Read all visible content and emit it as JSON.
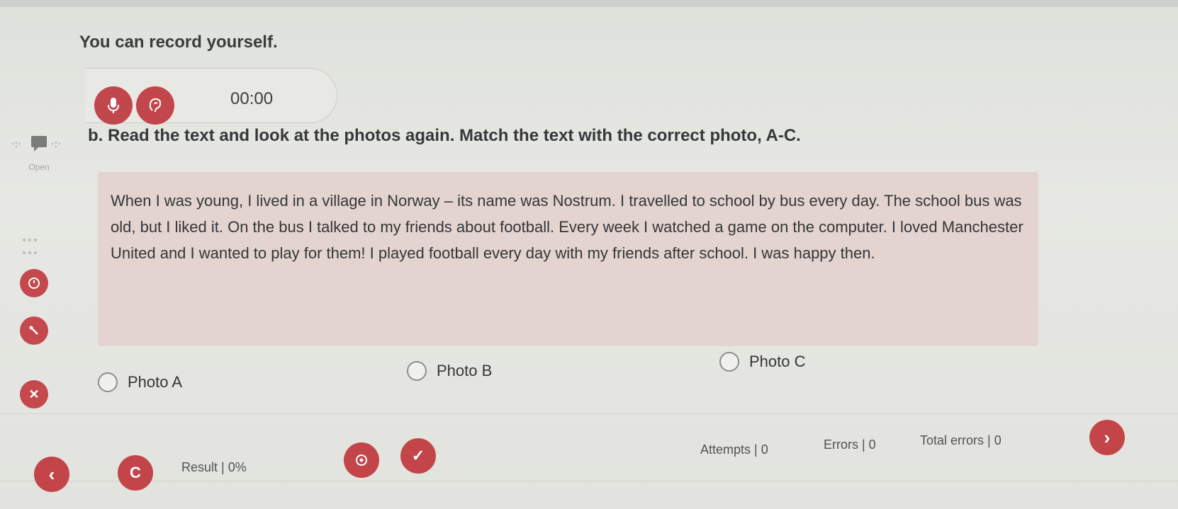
{
  "recording": {
    "heading": "You can record yourself.",
    "timer": "00:00",
    "mic_icon": "microphone-icon",
    "play_icon": "listen-icon"
  },
  "sidebar": {
    "open_label": "Open",
    "icons": [
      "chat-icon",
      "clock-icon",
      "tools-icon",
      "close-icon"
    ]
  },
  "task": {
    "instruction": "b. Read the text and look at the photos again. Match the text with the correct photo, A-C.",
    "passage": "When I was young, I lived in a village in Norway – its name was Nostrum. I travelled to school by bus every day. The school bus was old, but I liked it. On the bus I talked to my friends about football. Every week I watched a game on the computer. I loved Manchester United and I wanted to play for them! I played football every day with my friends after school. I was happy then."
  },
  "options": [
    {
      "label": "Photo A",
      "selected": false
    },
    {
      "label": "Photo B",
      "selected": false
    },
    {
      "label": "Photo C",
      "selected": false
    }
  ],
  "footer": {
    "result": "Result | 0%",
    "attempts": "Attempts | 0",
    "errors": "Errors | 0",
    "total_errors": "Total errors | 0"
  },
  "colors": {
    "accent": "#c3454a",
    "panel": "#e3d4d0",
    "background": "#e4e5e0"
  }
}
